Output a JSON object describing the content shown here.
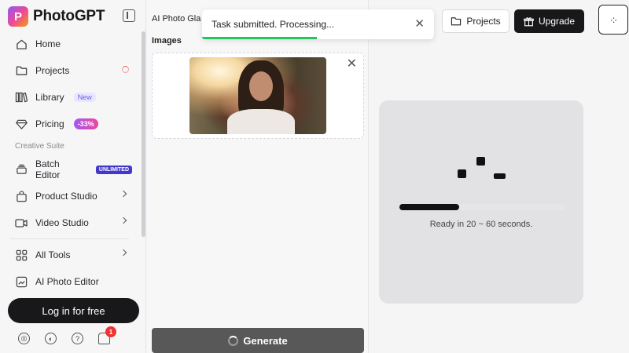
{
  "app": {
    "name": "PhotoGPT",
    "logo_letter": "P"
  },
  "sidebar": {
    "items": [
      {
        "label": "Home",
        "icon": "home-icon"
      },
      {
        "label": "Projects",
        "icon": "folder-icon"
      },
      {
        "label": "Library",
        "icon": "library-icon",
        "badge": "New"
      },
      {
        "label": "Pricing",
        "icon": "diamond-icon",
        "badge": "-33%"
      }
    ],
    "section_label": "Creative Suite",
    "suite_items": [
      {
        "label": "Batch Editor",
        "icon": "layers-icon",
        "badge": "UNLIMITED"
      },
      {
        "label": "Product Studio",
        "icon": "bag-icon"
      },
      {
        "label": "Video Studio",
        "icon": "video-icon"
      }
    ],
    "tools_items": [
      {
        "label": "All Tools",
        "icon": "grid-icon"
      },
      {
        "label": "AI Photo Editor",
        "icon": "photo-edit-icon"
      }
    ],
    "login_label": "Log in for free",
    "notification_count": "1"
  },
  "mid": {
    "title": "AI Photo Gla",
    "images_label": "Images",
    "generate_label": "Generate"
  },
  "header": {
    "projects_label": "Projects",
    "upgrade_label": "Upgrade",
    "menu_glyph": "·:·"
  },
  "toast": {
    "message": "Task submitted. Processing..."
  },
  "result": {
    "ready_text": "Ready in 20 ~ 60 seconds.",
    "progress": 0.36
  },
  "colors": {
    "accent_dark": "#18181b",
    "toast_progress": "#22c55e",
    "notif": "#ee3333"
  }
}
